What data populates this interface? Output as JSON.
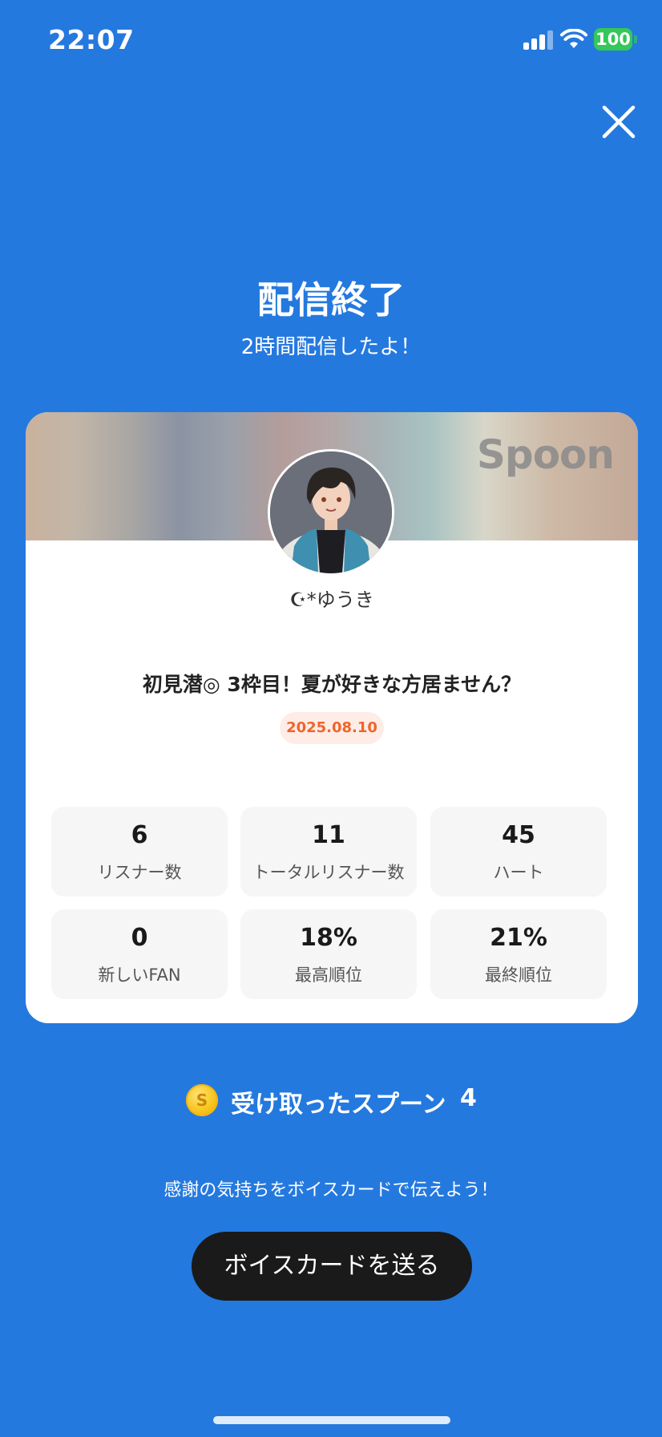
{
  "status_bar": {
    "time": "22:07",
    "battery": "100"
  },
  "header": {
    "title": "配信終了",
    "subtitle": "2時間配信したよ！"
  },
  "card": {
    "brand": "Spoon",
    "host_name": "☪︎*ゆうき",
    "stream_title": "初見潜◎ 3枠目！夏が好きな方居ません？",
    "date": "2025.08.10",
    "stats": [
      {
        "value": "6",
        "label": "リスナー数"
      },
      {
        "value": "11",
        "label": "トータルリスナー数"
      },
      {
        "value": "45",
        "label": "ハート"
      },
      {
        "value": "0",
        "label": "新しいFAN"
      },
      {
        "value": "18%",
        "label": "最高順位"
      },
      {
        "value": "21%",
        "label": "最終順位"
      }
    ]
  },
  "spoons": {
    "coin_symbol": "S",
    "label": "受け取ったスプーン",
    "count": "4"
  },
  "thanks_message": "感謝の気持ちをボイスカードで伝えよう！",
  "voice_card_button": "ボイスカードを送る",
  "colors": {
    "background": "#2479DF",
    "date_accent": "#F0642C",
    "button": "#1A1A1A"
  }
}
